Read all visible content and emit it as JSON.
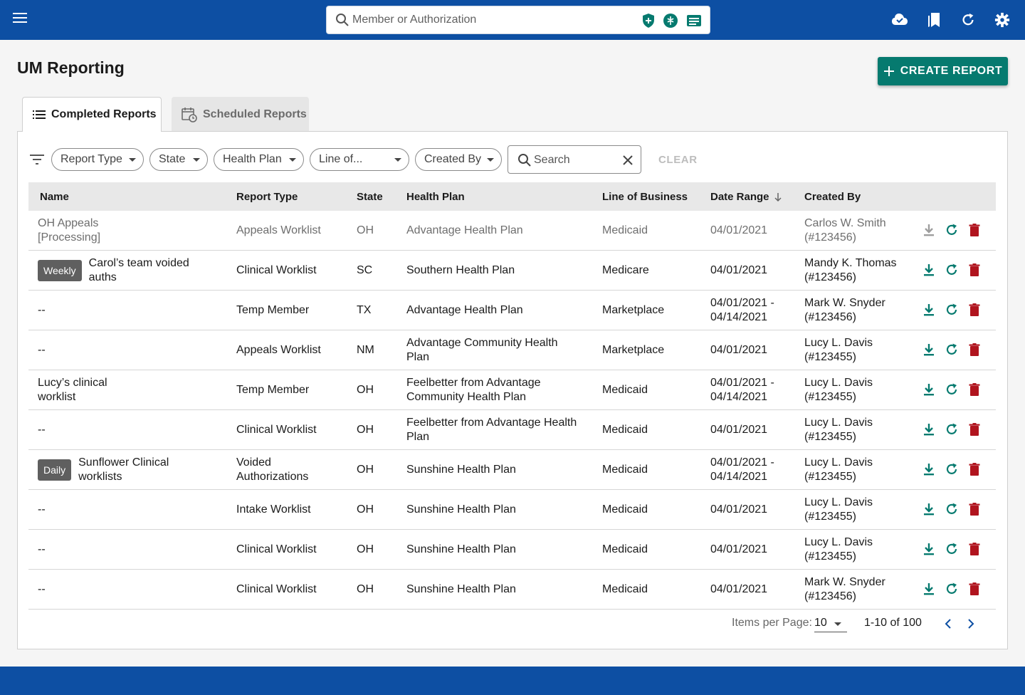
{
  "global_search": {
    "placeholder": "Member or Authorization"
  },
  "page_title": "UM Reporting",
  "create_button": "CREATE REPORT",
  "tabs": [
    {
      "label": "Completed Reports",
      "active": true
    },
    {
      "label": "Scheduled Reports",
      "active": false
    }
  ],
  "filters": {
    "chips": [
      "Report Type",
      "State",
      "Health Plan",
      "Line of...",
      "Created By"
    ],
    "search_placeholder": "Search",
    "clear_label": "CLEAR"
  },
  "table": {
    "columns": [
      "Name",
      "Report Type",
      "State",
      "Health Plan",
      "Line of Business",
      "Date Range",
      "Created By"
    ],
    "rows": [
      {
        "badge": "",
        "name": "OH Appeals [Processing]",
        "type": "Appeals Worklist",
        "state": "OH",
        "plan": "Advantage Health Plan",
        "lob": "Medicaid",
        "date": "04/01/2021",
        "created": "Carlos W. Smith (#123456)",
        "processing": true
      },
      {
        "badge": "Weekly",
        "name": "Carol’s team voided auths",
        "type": "Clinical Worklist",
        "state": "SC",
        "plan": "Southern Health Plan",
        "lob": "Medicare",
        "date": "04/01/2021",
        "created": "Mandy K. Thomas (#123456)",
        "processing": false
      },
      {
        "badge": "",
        "name": "--",
        "type": "Temp Member",
        "state": "TX",
        "plan": "Advantage Health Plan",
        "lob": "Marketplace",
        "date": "04/01/2021 - 04/14/2021",
        "created": "Mark W. Snyder (#123456)",
        "processing": false
      },
      {
        "badge": "",
        "name": "--",
        "type": "Appeals Worklist",
        "state": "NM",
        "plan": "Advantage Community Health Plan",
        "lob": "Marketplace",
        "date": "04/01/2021",
        "created": "Lucy L. Davis (#123455)",
        "processing": false
      },
      {
        "badge": "",
        "name": "Lucy’s clinical worklist",
        "type": "Temp Member",
        "state": "OH",
        "plan": "Feelbetter from Advantage Community Health Plan",
        "lob": "Medicaid",
        "date": "04/01/2021 - 04/14/2021",
        "created": "Lucy L. Davis (#123455)",
        "processing": false
      },
      {
        "badge": "",
        "name": "--",
        "type": "Clinical Worklist",
        "state": "OH",
        "plan": "Feelbetter from Advantage Health Plan",
        "lob": "Medicaid",
        "date": "04/01/2021",
        "created": "Lucy L. Davis (#123455)",
        "processing": false
      },
      {
        "badge": "Daily",
        "name": "Sunflower Clinical worklists",
        "type": "Voided Authorizations",
        "state": "OH",
        "plan": "Sunshine Health Plan",
        "lob": "Medicaid",
        "date": "04/01/2021 - 04/14/2021",
        "created": "Lucy L. Davis (#123455)",
        "processing": false
      },
      {
        "badge": "",
        "name": "--",
        "type": "Intake Worklist",
        "state": "OH",
        "plan": "Sunshine Health Plan",
        "lob": "Medicaid",
        "date": "04/01/2021",
        "created": "Lucy L. Davis (#123455)",
        "processing": false
      },
      {
        "badge": "",
        "name": "--",
        "type": "Clinical Worklist",
        "state": "OH",
        "plan": "Sunshine Health Plan",
        "lob": "Medicaid",
        "date": "04/01/2021",
        "created": "Lucy L. Davis (#123455)",
        "processing": false
      },
      {
        "badge": "",
        "name": "--",
        "type": "Clinical Worklist",
        "state": "OH",
        "plan": "Sunshine Health Plan",
        "lob": "Medicaid",
        "date": "04/01/2021",
        "created": "Mark W. Snyder (#123456)",
        "processing": false
      }
    ]
  },
  "pagination": {
    "items_label": "Items per Page:",
    "per_page": "10",
    "range": "1-10 of 100"
  },
  "colors": {
    "primary": "#0d4fa3",
    "accent": "#067a6f",
    "danger": "#b0141e",
    "badge": "#5f5f5f"
  },
  "icons": [
    "menu-icon",
    "search-icon",
    "shield-plus-icon",
    "medical-icon",
    "id-card-icon",
    "cloud-check-icon",
    "bookmarks-icon",
    "refresh-icon",
    "gear-icon",
    "filter-icon",
    "download-icon",
    "rerun-icon",
    "trash-icon",
    "chevron-left-icon",
    "chevron-right-icon"
  ]
}
